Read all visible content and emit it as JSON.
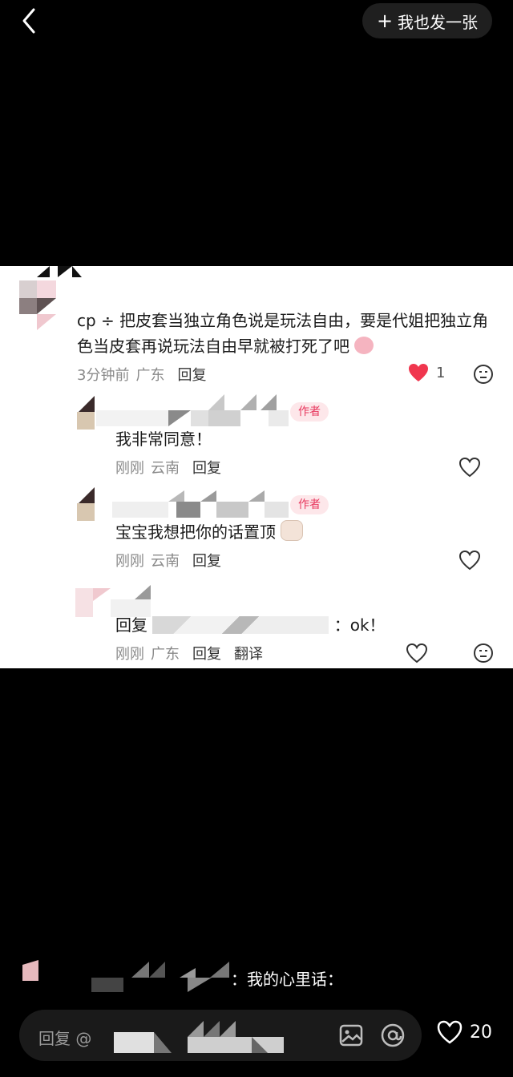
{
  "header": {
    "post_label": "我也发一张",
    "plus_symbol": "+"
  },
  "comment": {
    "prefix": "cp ÷",
    "text": "把皮套当独立角色说是玩法自由，要是代姐把独立角色当皮套再说玩法自由早就被打死了吧",
    "time": "3分钟前",
    "location": "广东",
    "reply_label": "回复",
    "like_count": "1"
  },
  "replies": [
    {
      "badge": "作者",
      "text": "我非常同意！",
      "time": "刚刚",
      "location": "云南",
      "reply_label": "回复"
    },
    {
      "badge": "作者",
      "text": "宝宝我想把你的话置顶",
      "time": "刚刚",
      "location": "云南",
      "reply_label": "回复"
    },
    {
      "prefix": "回复",
      "text": "：ok！",
      "time": "刚刚",
      "location": "广东",
      "reply_label": "回复",
      "translate_label": "翻译"
    }
  ],
  "overlay": {
    "text": "：我的心里话："
  },
  "input": {
    "placeholder": "回复 @"
  },
  "footer": {
    "like_count": "20"
  },
  "colors": {
    "accent_pink": "#e8395f",
    "heart_red": "#f0364e"
  },
  "icons": [
    "back-icon",
    "plus-icon",
    "heart-icon",
    "emoji-icon",
    "image-icon",
    "at-icon"
  ]
}
